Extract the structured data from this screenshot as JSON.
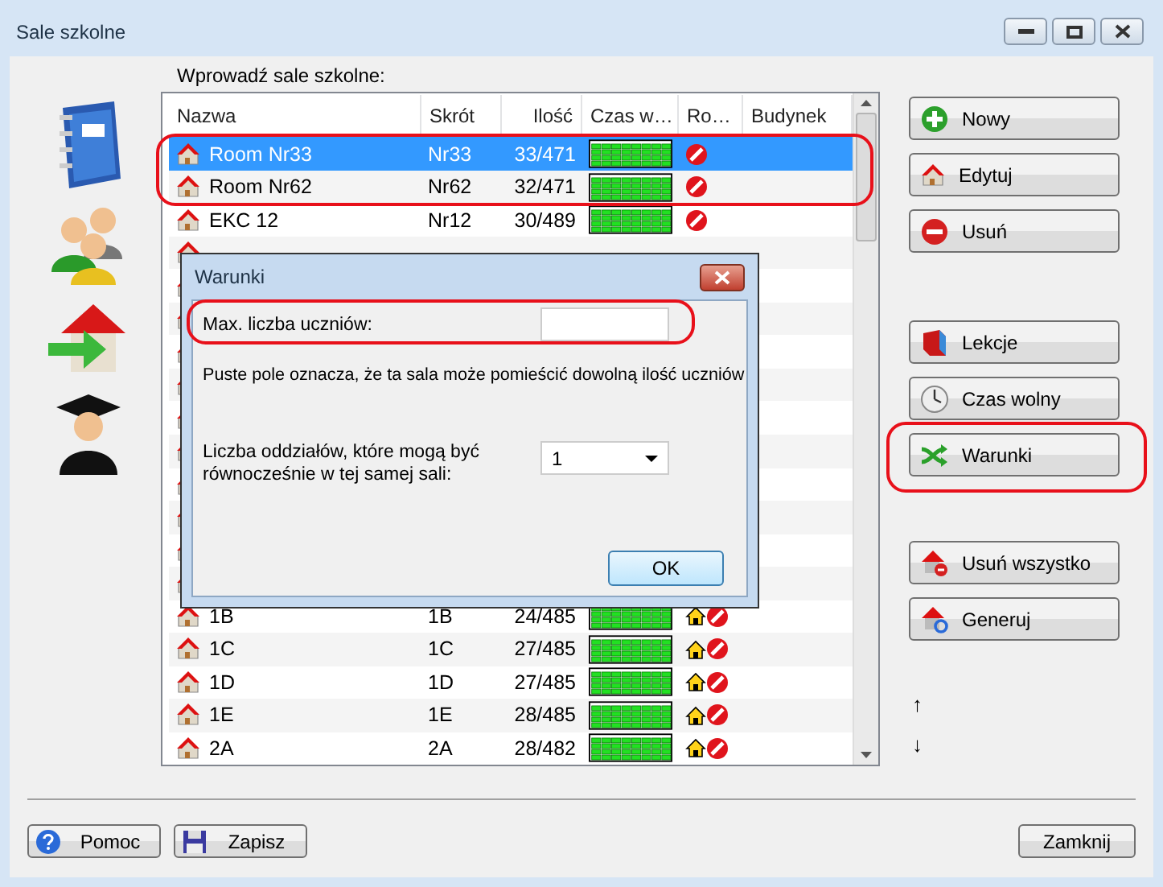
{
  "window": {
    "title": "Sale szkolne"
  },
  "list_label": "Wprowadź sale szkolne:",
  "table": {
    "columns": [
      "Nazwa",
      "Skrót",
      "Ilość",
      "Czas w…",
      "Ro…",
      "Budynek"
    ],
    "rows": [
      {
        "kind": "row",
        "name": "Room Nr33",
        "short": "Nr33",
        "count": "33/471",
        "home": false,
        "blocked": true,
        "selected": true
      },
      {
        "kind": "row",
        "name": "Room Nr62",
        "short": "Nr62",
        "count": "32/471",
        "home": false,
        "blocked": true,
        "selected": false
      },
      {
        "kind": "row",
        "name": "EKC  12",
        "short": "Nr12",
        "count": "30/489",
        "home": false,
        "blocked": true,
        "selected": false
      },
      {
        "kind": "covered"
      },
      {
        "kind": "covered"
      },
      {
        "kind": "covered"
      },
      {
        "kind": "covered"
      },
      {
        "kind": "covered"
      },
      {
        "kind": "covered"
      },
      {
        "kind": "covered"
      },
      {
        "kind": "covered"
      },
      {
        "kind": "covered"
      },
      {
        "kind": "covered"
      },
      {
        "kind": "covered"
      },
      {
        "kind": "row",
        "name": "1B",
        "short": "1B",
        "count": "24/485",
        "home": true,
        "blocked": true,
        "selected": false
      },
      {
        "kind": "row",
        "name": "1C",
        "short": "1C",
        "count": "27/485",
        "home": true,
        "blocked": true,
        "selected": false
      },
      {
        "kind": "row",
        "name": "1D",
        "short": "1D",
        "count": "27/485",
        "home": true,
        "blocked": true,
        "selected": false
      },
      {
        "kind": "row",
        "name": "1E",
        "short": "1E",
        "count": "28/485",
        "home": true,
        "blocked": true,
        "selected": false
      },
      {
        "kind": "row",
        "name": "2A",
        "short": "2A",
        "count": "28/482",
        "home": true,
        "blocked": true,
        "selected": false
      }
    ]
  },
  "actions": [
    [
      "Nowy",
      "Edytuj",
      "Usuń"
    ],
    [
      "Lekcje",
      "Czas wolny",
      "Warunki"
    ],
    [
      "Usuń wszystko",
      "Generuj"
    ]
  ],
  "move_buttons": [
    "↑",
    "↓"
  ],
  "footer": {
    "left": [
      "Pomoc",
      "Zapisz"
    ],
    "right": "Zamknij"
  },
  "dialog": {
    "title": "Warunki",
    "max_label": "Max. liczba uczniów:",
    "hint": "Puste pole oznacza, że ta sala może pomieścić dowolną ilość uczniów",
    "groups_label": "Liczba oddziałów, które mogą być równocześnie w tej samej sali:",
    "groups_value": "1",
    "ok": "OK"
  }
}
